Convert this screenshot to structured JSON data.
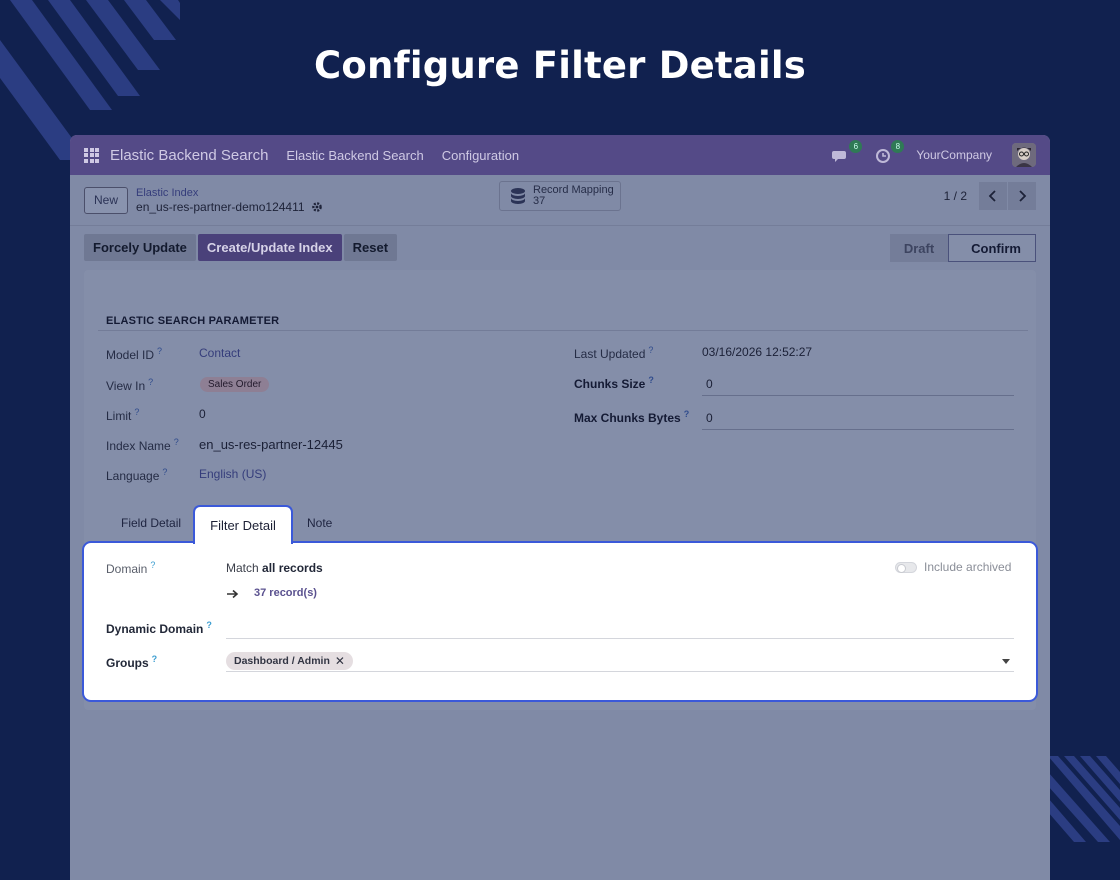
{
  "hero": {
    "title": "Configure Filter Details"
  },
  "topbar": {
    "app_name": "Elastic Backend Search",
    "menu": [
      "Elastic Backend Search",
      "Configuration"
    ],
    "messages_count": "6",
    "activities_count": "8",
    "company": "YourCompany"
  },
  "control": {
    "new_label": "New",
    "breadcrumb_parent": "Elastic Index",
    "breadcrumb_current": "en_us-res-partner-demo124411",
    "smart_button": {
      "label": "Record Mapping",
      "count": "37"
    },
    "pager": "1 / 2"
  },
  "actions": {
    "forcely_update": "Forcely Update",
    "create_update": "Create/Update Index",
    "reset": "Reset"
  },
  "stages": {
    "draft": "Draft",
    "confirm": "Confirm"
  },
  "section": {
    "title": "ELASTIC SEARCH PARAMETER"
  },
  "fields": {
    "model_id": {
      "label": "Model ID",
      "value": "Contact"
    },
    "view_in": {
      "label": "View In",
      "value": "Sales Order"
    },
    "limit": {
      "label": "Limit",
      "value": "0"
    },
    "index_name": {
      "label": "Index Name",
      "value": "en_us-res-partner-12445"
    },
    "language": {
      "label": "Language",
      "value": "English (US)"
    },
    "last_updated": {
      "label": "Last Updated",
      "value": "03/16/2026 12:52:27"
    },
    "chunks_size": {
      "label": "Chunks Size",
      "value": "0"
    },
    "max_chunks_bytes": {
      "label": "Max Chunks Bytes",
      "value": "0"
    }
  },
  "tabs": {
    "field_detail": "Field Detail",
    "filter_detail": "Filter Detail",
    "note": "Note"
  },
  "filter_panel": {
    "domain_label": "Domain",
    "match_prefix": "Match",
    "match_value": "all records",
    "records_link": "37 record(s)",
    "include_archived": "Include archived",
    "dynamic_domain_label": "Dynamic Domain",
    "groups_label": "Groups",
    "group_tag": "Dashboard / Admin"
  },
  "help_mark": "?",
  "colors": {
    "background": "#11214f",
    "topbar": "#544a87",
    "highlight": "#3b59d9"
  }
}
